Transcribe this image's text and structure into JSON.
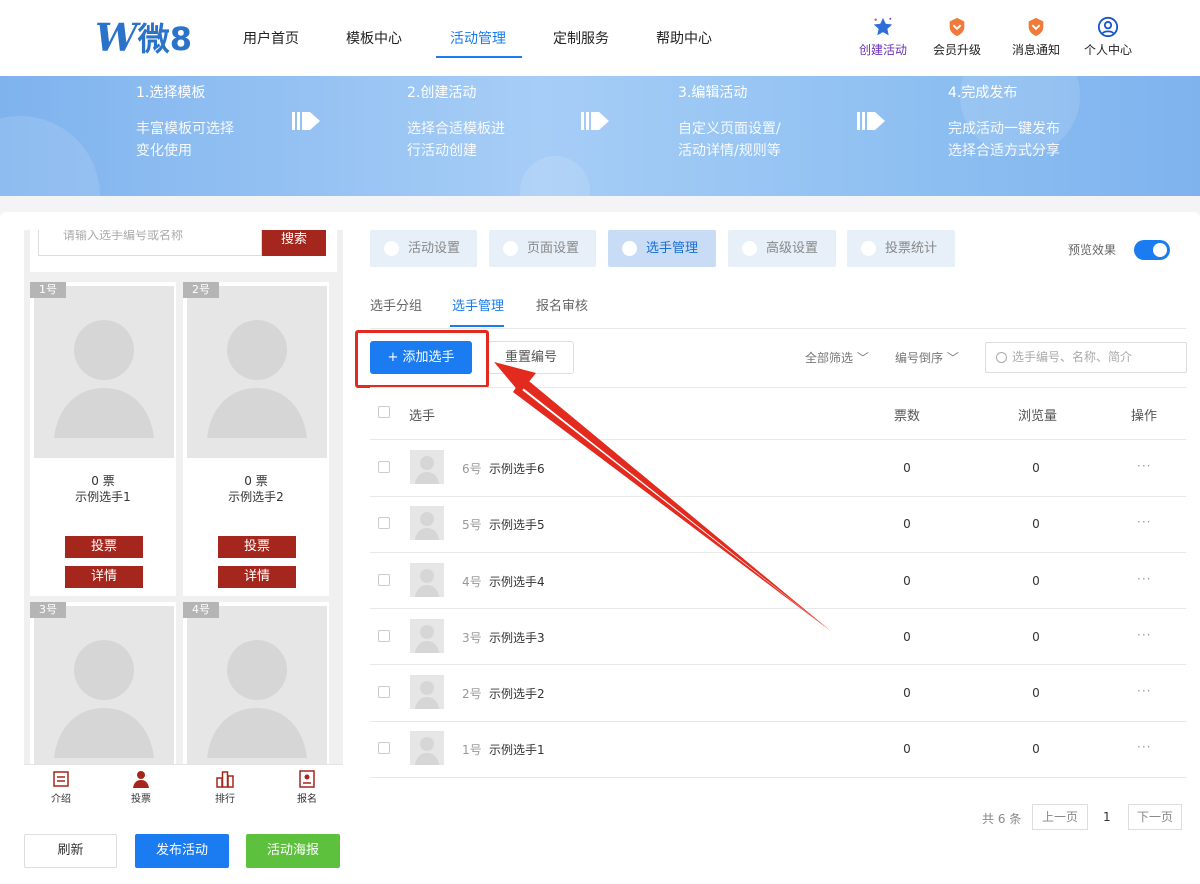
{
  "brand": {
    "logo_mark": "W",
    "logo_text": "微8"
  },
  "nav": {
    "items": [
      {
        "label": "用户首页"
      },
      {
        "label": "模板中心"
      },
      {
        "label": "活动管理"
      },
      {
        "label": "定制服务"
      },
      {
        "label": "帮助中心"
      }
    ],
    "active_index": 2
  },
  "tools": [
    {
      "label": "创建活动",
      "icon": "star-icon"
    },
    {
      "label": "会员升级",
      "icon": "vip-shield-icon"
    },
    {
      "label": "消息通知",
      "icon": "notification-icon"
    },
    {
      "label": "个人中心",
      "icon": "user-circle-icon"
    }
  ],
  "steps": [
    {
      "title": "1.选择模板",
      "desc1": "丰富模板可选择",
      "desc2": "变化使用"
    },
    {
      "title": "2.创建活动",
      "desc1": "选择合适模板进",
      "desc2": "行活动创建"
    },
    {
      "title": "3.编辑活动",
      "desc1": "自定义页面设置/",
      "desc2": "活动详情/规则等"
    },
    {
      "title": "4.完成发布",
      "desc1": "完成活动一键发布",
      "desc2": "选择合适方式分享"
    }
  ],
  "phone": {
    "search_placeholder": "请输入选手编号或名称",
    "search_button": "搜索",
    "cards": [
      {
        "num": "1号",
        "votes": "0 票",
        "name": "示例选手1"
      },
      {
        "num": "2号",
        "votes": "0 票",
        "name": "示例选手2"
      },
      {
        "num": "3号"
      },
      {
        "num": "4号"
      }
    ],
    "vote_label": "投票",
    "detail_label": "详情",
    "tabbar": [
      {
        "label": "介绍",
        "icon": "intro-icon"
      },
      {
        "label": "投票",
        "icon": "person-icon"
      },
      {
        "label": "排行",
        "icon": "ranking-icon"
      },
      {
        "label": "报名",
        "icon": "signup-icon"
      }
    ]
  },
  "bottom_buttons": {
    "refresh": "刷新",
    "publish": "发布活动",
    "poster": "活动海报"
  },
  "settings_tabs": [
    {
      "label": "活动设置"
    },
    {
      "label": "页面设置"
    },
    {
      "label": "选手管理"
    },
    {
      "label": "高级设置"
    },
    {
      "label": "投票统计"
    }
  ],
  "settings_active": 2,
  "preview": {
    "label": "预览效果",
    "enabled": true
  },
  "sub_tabs": [
    {
      "label": "选手分组"
    },
    {
      "label": "选手管理"
    },
    {
      "label": "报名审核"
    }
  ],
  "toolbar": {
    "add_label": "+ 添加选手",
    "renumber_label": "重置编号",
    "filter_all": "全部筛选",
    "filter_order": "编号倒序",
    "search_placeholder": "选手编号、名称、简介"
  },
  "table": {
    "headers": {
      "player": "选手",
      "votes": "票数",
      "views": "浏览量",
      "actions": "操作"
    },
    "rows": [
      {
        "num": "6号",
        "name": "示例选手6",
        "votes": "0",
        "views": "0"
      },
      {
        "num": "5号",
        "name": "示例选手5",
        "votes": "0",
        "views": "0"
      },
      {
        "num": "4号",
        "name": "示例选手4",
        "votes": "0",
        "views": "0"
      },
      {
        "num": "3号",
        "name": "示例选手3",
        "votes": "0",
        "views": "0"
      },
      {
        "num": "2号",
        "name": "示例选手2",
        "votes": "0",
        "views": "0"
      },
      {
        "num": "1号",
        "name": "示例选手1",
        "votes": "0",
        "views": "0"
      }
    ],
    "more_label": "···"
  },
  "pagination": {
    "total": "共 6 条",
    "prev": "上一页",
    "current": "1",
    "next": "下一页"
  },
  "colors": {
    "primary": "#1a7cf0",
    "vote_red": "#a5261c",
    "highlight_red": "#e32a1e",
    "poster_green": "#5ec13d"
  }
}
